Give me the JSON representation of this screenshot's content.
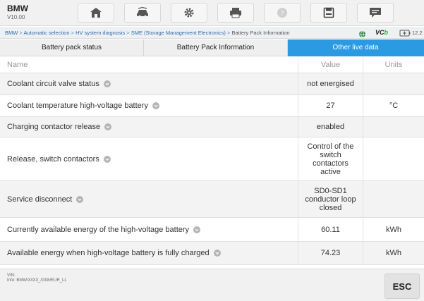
{
  "app": {
    "title": "BMW",
    "version": "V10.00"
  },
  "toolbar": {
    "buttons": [
      {
        "icon": "home-icon"
      },
      {
        "icon": "vehicle-swap-icon"
      },
      {
        "icon": "settings-gear-icon"
      },
      {
        "icon": "print-icon"
      },
      {
        "icon": "help-icon"
      },
      {
        "icon": "save-icon"
      },
      {
        "icon": "message-icon"
      }
    ]
  },
  "breadcrumb": {
    "items": [
      "BMW",
      "Automatic selection",
      "HV system diagnosis",
      "SME (Storage Management Electronics)",
      "Battery Pack Information"
    ],
    "separator": " > "
  },
  "status": {
    "vci_prefix": "VC",
    "vci_suffix": "b",
    "battery_voltage": "12.2"
  },
  "tabs": [
    {
      "label": "Battery pack status",
      "active": false
    },
    {
      "label": "Battery Pack Information",
      "active": false
    },
    {
      "label": "Other live data",
      "active": true
    }
  ],
  "table": {
    "headers": {
      "name": "Name",
      "value": "Value",
      "units": "Units"
    },
    "rows": [
      {
        "name": "Coolant circuit valve status",
        "value": "not energised",
        "units": ""
      },
      {
        "name": "Coolant temperature high-voltage battery",
        "value": "27",
        "units": "°C"
      },
      {
        "name": "Charging contactor release",
        "value": "enabled",
        "units": ""
      },
      {
        "name": "Release, switch contactors",
        "value": "Control of the switch contactors active",
        "units": ""
      },
      {
        "name": "Service disconnect",
        "value": "SD0-SD1 conductor loop closed",
        "units": ""
      },
      {
        "name": "Currently available energy of the high-voltage battery",
        "value": "60.11",
        "units": "kWh"
      },
      {
        "name": "Available energy when high-voltage battery is fully charged",
        "value": "74.23",
        "units": "kWh"
      }
    ]
  },
  "footer": {
    "vin_label": "VIN:",
    "info_text": "Info: BMW/X/iX3_/G08/EUR_LL",
    "esc_label": "ESC"
  },
  "colors": {
    "accent": "#2a9ae3",
    "link": "#2f6aa8"
  }
}
